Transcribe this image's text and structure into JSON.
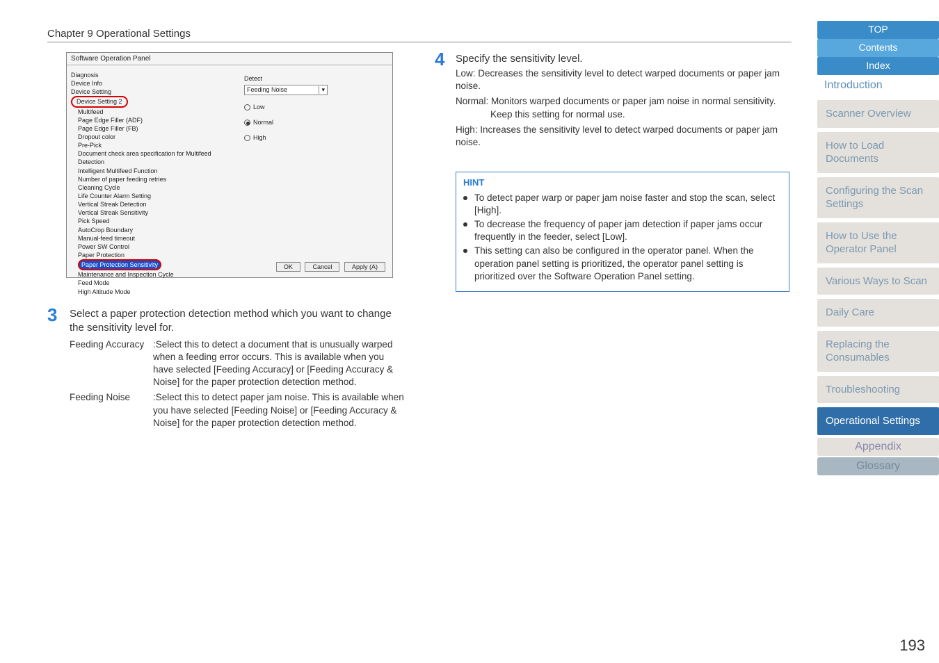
{
  "chapter": "Chapter 9 Operational Settings",
  "dialog": {
    "title": "Software Operation Panel",
    "tree": {
      "diagnosis": "Diagnosis",
      "deviceInfo": "Device Info",
      "deviceSetting": "Device Setting",
      "deviceSetting2": "Device Setting 2",
      "items": [
        "Multifeed",
        "Page Edge Filler (ADF)",
        "Page Edge Filler (FB)",
        "Dropout color",
        "Pre-Pick",
        "Document check area specification for Multifeed Detection",
        "Intelligent Multifeed Function",
        "Number of paper feeding retries",
        "Cleaning Cycle",
        "Life Counter Alarm Setting",
        "Vertical Streak Detection",
        "Vertical Streak Sensitivity",
        "Pick Speed",
        "AutoCrop Boundary",
        "Manual-feed timeout",
        "Power SW Control",
        "Paper Protection"
      ],
      "selected": "Paper Protection Sensitivity",
      "after": [
        "Maintenance and Inspection Cycle",
        "Feed Mode",
        "High Altitude Mode"
      ]
    },
    "rightPane": {
      "detectLabel": "Detect",
      "selectValue": "Feeding Noise",
      "radios": {
        "low": "Low",
        "normal": "Normal",
        "high": "High"
      }
    },
    "buttons": {
      "ok": "OK",
      "cancel": "Cancel",
      "apply": "Apply (A)"
    }
  },
  "step3": {
    "num": "3",
    "lead": "Select a paper protection detection method which you want to change the sensitivity level for.",
    "rows": [
      {
        "term": "Feeding Accuracy",
        "text": ":Select this to detect a document that is unusually warped when a feeding error occurs. This is available when you have selected [Feeding Accuracy] or [Feeding Accuracy & Noise] for the paper protection detection method."
      },
      {
        "term": "Feeding Noise",
        "text": ":Select this to detect paper jam noise. This is available when you have selected [Feeding Noise] or [Feeding Accuracy & Noise] for the paper protection detection method."
      }
    ]
  },
  "step4": {
    "num": "4",
    "lead": "Specify the sensitivity level.",
    "lines": [
      {
        "label": "Low:",
        "text": "Decreases the sensitivity level to detect warped documents or paper jam noise."
      },
      {
        "label": "Normal:",
        "text": "Monitors warped documents or paper jam noise in normal sensitivity.",
        "extra": "Keep this setting for normal use."
      },
      {
        "label": "High:",
        "text": "Increases the sensitivity level to detect warped documents or paper jam noise."
      }
    ]
  },
  "hint": {
    "title": "HINT",
    "bullets": [
      "To detect paper warp or paper jam noise faster and stop the scan, select [High].",
      "To decrease the frequency of paper jam detection if paper jams occur frequently in the feeder, select [Low].",
      "This setting can also be configured in the operator panel. When the operation panel setting is prioritized, the operator panel setting is prioritized over the Software Operation Panel setting."
    ]
  },
  "sidebar": {
    "top": "TOP",
    "contents": "Contents",
    "index": "Index",
    "introduction": "Introduction",
    "sections": [
      "Scanner Overview",
      "How to Load Documents",
      "Configuring the Scan Settings",
      "How to Use the Operator Panel",
      "Various Ways to Scan",
      "Daily Care",
      "Replacing the Consumables",
      "Troubleshooting",
      "Operational Settings"
    ],
    "appendix": "Appendix",
    "glossary": "Glossary"
  },
  "pageNum": "193"
}
